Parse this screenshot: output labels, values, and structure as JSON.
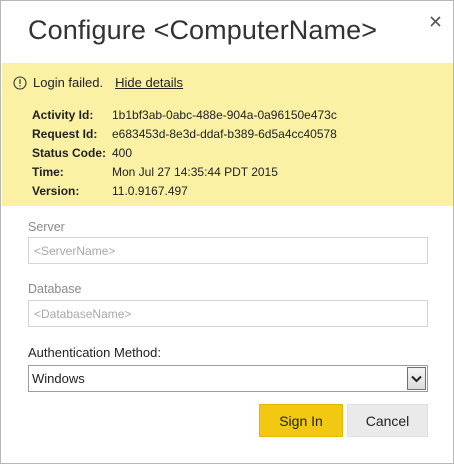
{
  "dialog": {
    "title": "Configure <ComputerName>",
    "close_icon": "close-icon"
  },
  "error_banner": {
    "icon": "warning-circle-icon",
    "message": "Login failed.",
    "toggle_link": "Hide details",
    "details": [
      {
        "label": "Activity Id:",
        "value": "1b1bf3ab-0abc-488e-904a-0a96150e473c"
      },
      {
        "label": "Request Id:",
        "value": "e683453d-8e3d-ddaf-b389-6d5a4cc40578"
      },
      {
        "label": "Status Code:",
        "value": "400"
      },
      {
        "label": "Time:",
        "value": "Mon Jul 27 14:35:44 PDT 2015"
      },
      {
        "label": "Version:",
        "value": "11.0.9167.497"
      }
    ],
    "background_color": "#faf1a5"
  },
  "form": {
    "server": {
      "label": "Server",
      "value": "",
      "placeholder": "<ServerName>"
    },
    "database": {
      "label": "Database",
      "value": "",
      "placeholder": "<DatabaseName>"
    },
    "auth": {
      "label": "Authentication Method:",
      "selected": "Windows",
      "arrow_icon": "chevron-down-icon"
    }
  },
  "actions": {
    "sign_in_label": "Sign In",
    "cancel_label": "Cancel",
    "primary_color": "#f2c811"
  }
}
